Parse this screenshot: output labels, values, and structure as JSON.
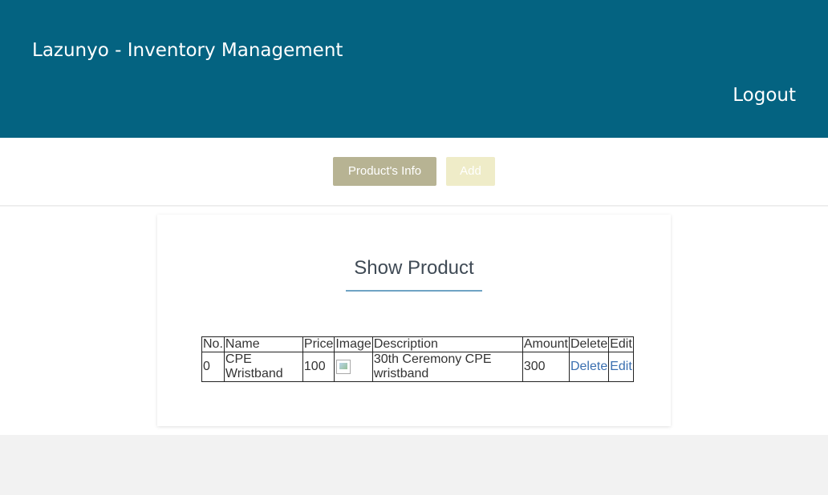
{
  "header": {
    "brand": "Lazunyo - Inventory Management",
    "logout": "Logout"
  },
  "nav": {
    "products_info": "Product's Info",
    "add": "Add"
  },
  "main": {
    "title": "Show Product",
    "table": {
      "columns": [
        "No.",
        "Name",
        "Price",
        "Image",
        "Description",
        "Amount",
        "Delete",
        "Edit"
      ],
      "rows": [
        {
          "no": "0",
          "name": "CPE Wristband",
          "price": "100",
          "image": "broken-image-icon",
          "description": "30th Ceremony CPE wristband",
          "amount": "300",
          "delete": "Delete",
          "edit": "Edit"
        }
      ]
    }
  },
  "colors": {
    "header_bg": "#046381",
    "info_button": "#b7b393",
    "add_button": "#efecc8",
    "link": "#3a6fb0"
  }
}
